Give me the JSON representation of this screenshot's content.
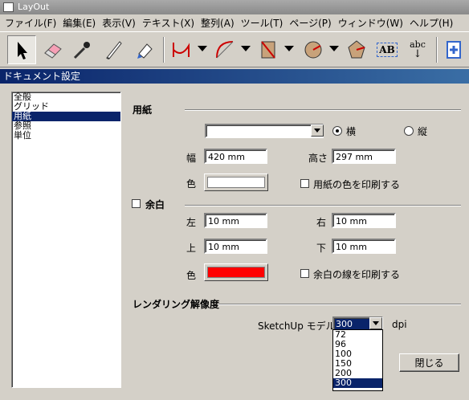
{
  "app": {
    "title": "LayOut"
  },
  "menu": [
    "ファイル(F)",
    "編集(E)",
    "表示(V)",
    "テキスト(X)",
    "整列(A)",
    "ツール(T)",
    "ページ(P)",
    "ウィンドウ(W)",
    "ヘルプ(H)"
  ],
  "toolbar": {
    "icons": [
      "select-arrow-icon",
      "eraser-icon",
      "eyedropper-icon",
      "scissors-knife-icon",
      "style-bucket-icon",
      "line-tool-icon",
      "arc-tool-icon",
      "rectangle-tool-icon",
      "circle-tool-icon",
      "polygon-tool-icon",
      "text-tool-icon",
      "label-tool-icon",
      "add-page-icon"
    ],
    "text_label": "AB",
    "label_abc": "abc"
  },
  "dialog": {
    "title": "ドキュメント設定",
    "categories": [
      "全般",
      "グリッド",
      "用紙",
      "参照",
      "単位"
    ],
    "selected_category": "用紙",
    "paper": {
      "heading": "用紙",
      "size_value": "",
      "orientation_landscape": "横",
      "orientation_portrait": "縦",
      "width_label": "幅",
      "width_value": "420 mm",
      "height_label": "高さ",
      "height_value": "297 mm",
      "color_label": "色",
      "color": "#ffffff",
      "print_color_label": "用紙の色を印刷する"
    },
    "margin": {
      "heading": "余白",
      "left_label": "左",
      "left_value": "10 mm",
      "right_label": "右",
      "right_value": "10 mm",
      "top_label": "上",
      "top_value": "10 mm",
      "bottom_label": "下",
      "bottom_value": "10 mm",
      "color_label": "色",
      "color": "#ff0000",
      "print_lines_label": "余白の線を印刷する"
    },
    "rendering": {
      "heading": "レンダリング解像度",
      "model_label": "SketchUp モデル",
      "dpi_value": "300",
      "dpi_unit": "dpi",
      "dpi_options": [
        "72",
        "96",
        "100",
        "150",
        "200",
        "300"
      ],
      "dpi_selected": "300"
    },
    "close_label": "閉じる"
  }
}
